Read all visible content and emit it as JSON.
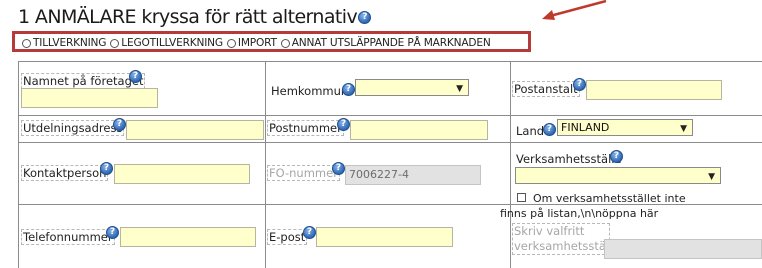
{
  "section": {
    "title": "1 ANMÄLARE kryssa för rätt alternativ"
  },
  "notifier_type": {
    "options": [
      "TILLVERKNING",
      "LEGOTILLVERKNING",
      "IMPORT",
      "ANNAT UTSLÄPPANDE PÅ MARKNADEN"
    ]
  },
  "fields": {
    "company_name": {
      "label": "Namnet på företaget",
      "value": ""
    },
    "home_municipality": {
      "label": "Hemkommun",
      "selected": ""
    },
    "postal_office": {
      "label": "Postanstalt",
      "value": ""
    },
    "delivery_address": {
      "label": "Utdelningsadress",
      "value": ""
    },
    "postal_code": {
      "label": "Postnummer",
      "value": ""
    },
    "country": {
      "label": "Land",
      "selected": "FINLAND"
    },
    "contact_person": {
      "label": "Kontaktperson",
      "value": ""
    },
    "business_id": {
      "label": "FO-nummer",
      "value": "7006227-4"
    },
    "place_of_business": {
      "label": "Verksamhetsställe",
      "selected": ""
    },
    "not_in_list_checkbox": {
      "label": "Om verksamhetsstället inte finns på listan,\\n\\nöppna här",
      "checked": false
    },
    "custom_place": {
      "label": "Skriv valfritt verksamhetsställe",
      "value": ""
    },
    "phone": {
      "label": "Telefonnummer",
      "value": ""
    },
    "email": {
      "label": "E-post",
      "value": ""
    }
  },
  "icons": {
    "help": "help-icon",
    "dropdown": "chevron-down-icon",
    "annotation": "arrow-icon"
  },
  "colors": {
    "input_background": "#ffffcc",
    "highlight_border": "#b53a3a",
    "help_icon": "#2e67b3",
    "disabled_background": "#e2e2e2"
  }
}
